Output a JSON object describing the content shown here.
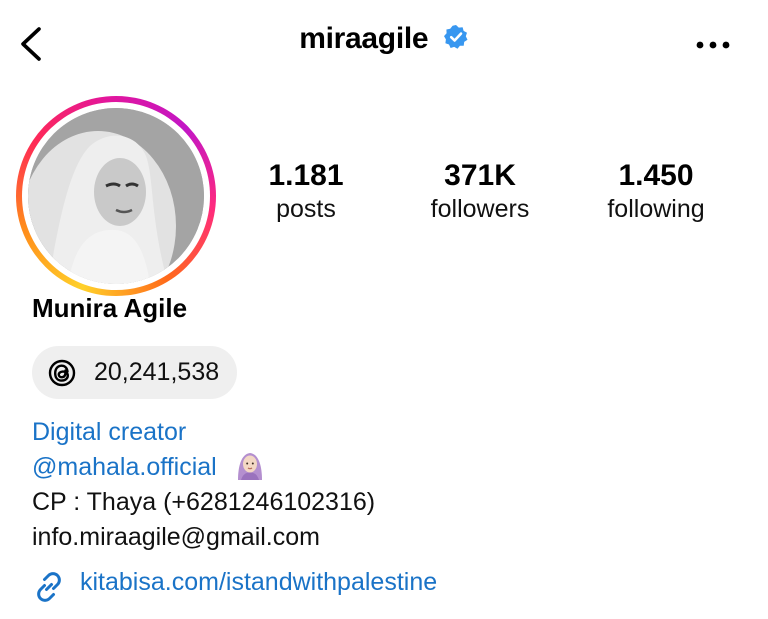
{
  "header": {
    "username": "miraagile",
    "verified": true,
    "back_icon": "chevron-left-icon",
    "more_icon": "ellipsis-icon"
  },
  "profile": {
    "display_name": "Munira Agile",
    "avatar": "profile-photo-black-and-white"
  },
  "stats": [
    {
      "value": "1.181",
      "label": "posts"
    },
    {
      "value": "371K",
      "label": "followers"
    },
    {
      "value": "1.450",
      "label": "following"
    }
  ],
  "threads": {
    "icon": "threads-icon",
    "count": "20,241,538"
  },
  "bio": {
    "category": "Digital creator",
    "mention": "@mahala.official",
    "mention_emoji": "woman-with-headscarf-emoji",
    "contact": "CP : Thaya (+6281246102316)",
    "email": "info.miraagile@gmail.com"
  },
  "link": {
    "icon": "link-icon",
    "text": "kitabisa.com/istandwithpalestine"
  },
  "colors": {
    "link_blue": "#1a73c7",
    "verified_blue": "#3897f0",
    "pill_bg": "#efefef"
  }
}
